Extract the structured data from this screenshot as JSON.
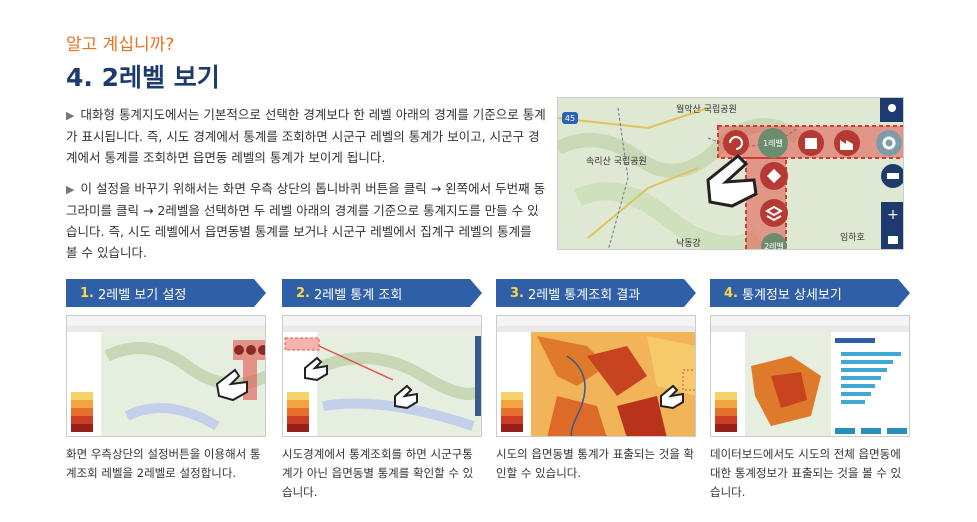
{
  "header": {
    "eyebrow": "알고 계십니까?",
    "title": "4. 2레벨 보기"
  },
  "intro": {
    "paragraph1": "대화형 통계지도에서는 기본적으로 선택한 경계보다 한 레벨 아래의 경계를 기준으로 통계가 표시됩니다. 즉, 시도 경계에서 통계를 조회하면 시군구 레벨의 통계가 보이고, 시군구 경계에서 통계를 조회하면 읍면동 레벨의 통계가 보이게 됩니다.",
    "paragraph2": "이 설정을 바꾸기 위해서는 화면 우측 상단의 톱니바퀴 버튼을 클릭 → 왼쪽에서 두번째 동그라미를 클릭 → 2레벨을 선택하면 두 레벨 아래의 경계를 기준으로 통계지도를 만들 수 있습니다. 즉, 시도 레벨에서 읍면동별 통계를 보거나 시군구 레벨에서 집계구 레벨의 통계를 볼 수 있습니다."
  },
  "main_map": {
    "labels": {
      "park1": "월악산 국립공원",
      "park2": "속리산 국립공원",
      "town1": "낙동강",
      "town2": "임하호",
      "road": "45"
    },
    "level_button": "1레벨",
    "level_button2": "2레벨",
    "icons": [
      "pin-icon",
      "gear-icon",
      "zoom-in-icon",
      "lock-icon",
      "refresh-icon",
      "building-icon",
      "factory-icon",
      "layers-icon",
      "diamond-icon"
    ]
  },
  "steps": [
    {
      "num": "1.",
      "label": "2레벨 보기 설정",
      "caption": "화면 우측상단의 설정버튼을 이용해서 통계조회 레벨을 2레벨로 설정합니다."
    },
    {
      "num": "2.",
      "label": "2레벨 통계 조회",
      "caption": "시도경계에서 통계조회를 하면 시군구통계가 아닌 읍면동별 통계를 확인할 수 있습니다."
    },
    {
      "num": "3.",
      "label": "2레벨 통계조회 결과",
      "caption": "시도의 읍면동별 통계가 표출되는 것을 확인할 수 있습니다."
    },
    {
      "num": "4.",
      "label": "통계정보 상세보기",
      "caption": "데이터보드에서도 시도의 전체 읍면동에 대한 통계정보가 표출되는 것을 볼 수 있습니다."
    }
  ],
  "colors": {
    "accent": "#e8721e",
    "title": "#1d3b6e",
    "banner": "#2f5fa6",
    "highlight": "#e2534b"
  }
}
